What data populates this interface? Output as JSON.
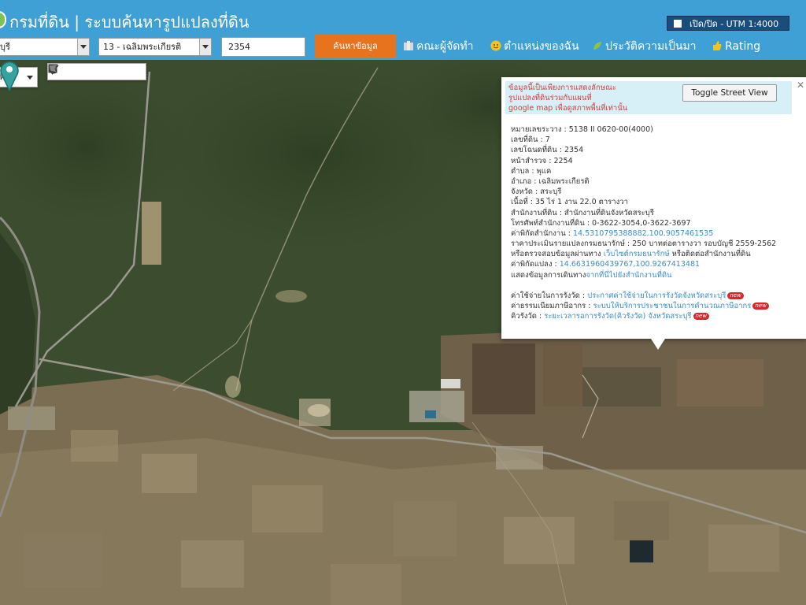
{
  "header": {
    "title": "กรมที่ดิน | ระบบค้นหารูปแปลงที่ดิน",
    "utm_toggle_label": "เปิด/ปิด - UTM 1:4000",
    "province_select": "บุรี",
    "district_select": "13 - เฉลิมพระเกียรติ",
    "parcel_input": "2354",
    "search_button": "ค้นหาข้อมูล",
    "nav": [
      {
        "label": "คณะผู้จัดทำ",
        "icon": "team-icon"
      },
      {
        "label": "ตำแหน่งของฉัน",
        "icon": "smiley-icon"
      },
      {
        "label": "ประวัติความเป็นมา",
        "icon": "leaf-icon"
      },
      {
        "label": "Rating",
        "icon": "thumbs-up-icon"
      }
    ],
    "colors": {
      "bar": "#3fa0d6",
      "search_button": "#e8731f",
      "utm_toggle": "#1b4d7a"
    }
  },
  "map": {
    "map_type": "ทียม",
    "tools": [
      "hand-icon",
      "marker-icon",
      "polyline-icon",
      "rectangle-icon",
      "circle-icon",
      "polygon-icon"
    ]
  },
  "info": {
    "notice_lines": [
      "ข้อมูลนี้เป็นเพียงการแสดงลักษณะ",
      "รูปแปลงที่ดินร่วมกับแผนที่",
      "google map เพื่อดูสภาพพื้นที่เท่านั้น"
    ],
    "street_view_button": "Toggle Street View",
    "rows": [
      "หมายเลขระวาง : 5138 II 0620-00(4000)",
      "เลขที่ดิน : 7",
      "เลขโฉนดที่ดิน : 2354",
      "หน้าสำรวจ : 2254",
      "ตำบล : พุแค",
      "อำเภอ : เฉลิมพระเกียรติ",
      "จังหวัด : สระบุรี",
      "เนื้อที่ : 35 ไร่ 1 งาน 22.0 ตารางวา",
      "สำนักงานที่ดิน : สำนักงานที่ดินจังหวัดสระบุรี",
      "โทรศัพท์สำนักงานที่ดิน : 0-3622-3054,0-3622-3697"
    ],
    "office_coord_label": "ค่าพิกัดสำนักงาน : ",
    "office_coord": "14.5310795388882,100.9057461535",
    "price_row": "ราคาประเมินรายแปลงกรมธนารักษ์ : 250 บาทต่อตารางวา รอบบัญชี 2559-2562",
    "check_prefix": "หรือตรวจสอบข้อมูลผ่านทาง ",
    "check_link": "เว็บไซต์กรมธนารักษ์",
    "check_suffix": " หรือติดต่อสำนักงานที่ดิน",
    "parcel_coord_label": "ค่าพิกัดแปลง : ",
    "parcel_coord": "14.6631960439767,100.9267413481",
    "route_prefix": "แสดงข้อมูลการเดินทาง",
    "route_link": "จากที่นี่ไปยังสำนักงานที่ดิน",
    "fee_rows": [
      {
        "label": "ค่าใช้จ่ายในการรังวัด : ",
        "link": "ประกาศค่าใช้จ่ายในการรังวัดจังหวัดสระบุรี"
      },
      {
        "label": "ค่าธรรมเนียมภาษีอากร : ",
        "link": "ระบบให้บริการประชาชนในการคำนวณภาษีอากร"
      },
      {
        "label": "คิวรังวัด : ",
        "link": "ระยะเวลารอการรังวัด(คิวรังวัด) จังหวัดสระบุรี"
      }
    ],
    "new_badge": "new"
  }
}
